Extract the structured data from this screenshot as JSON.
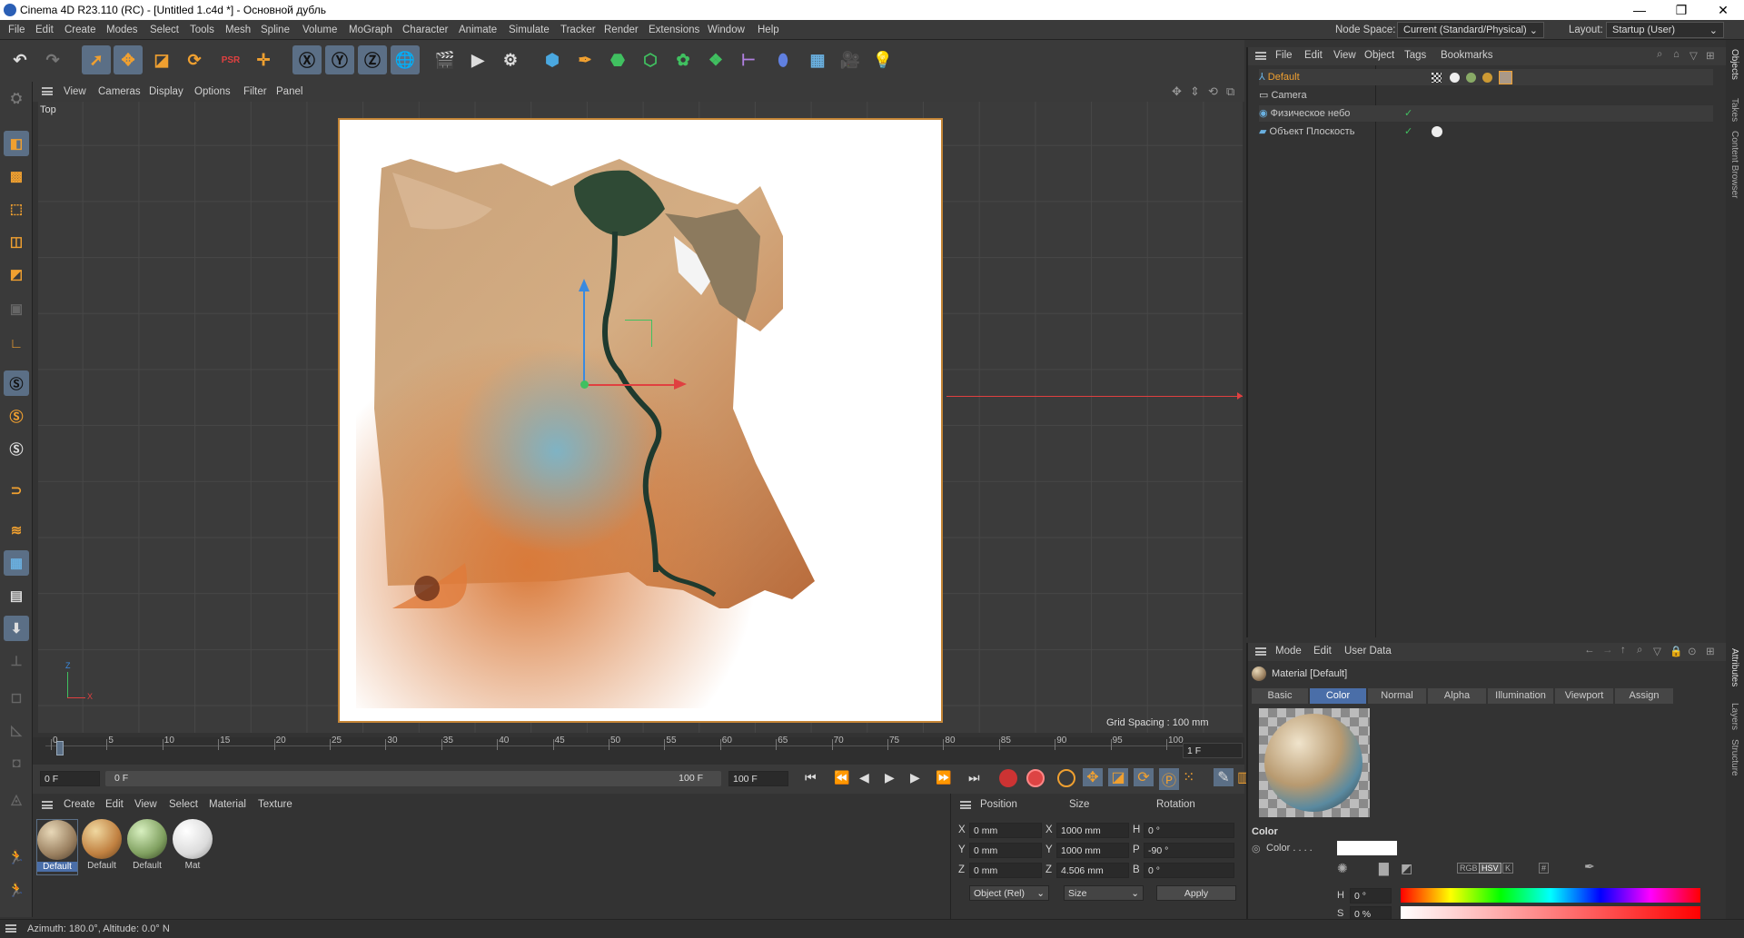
{
  "window": {
    "title": "Cinema 4D R23.110 (RC) - [Untitled 1.c4d *] - Основной дубль",
    "minimize": "—",
    "maximize": "❐",
    "close": "✕"
  },
  "menubar": {
    "items": [
      "File",
      "Edit",
      "Create",
      "Modes",
      "Select",
      "Tools",
      "Mesh",
      "Spline",
      "Volume",
      "MoGraph",
      "Character",
      "Animate",
      "Simulate",
      "Tracker",
      "Render",
      "Extensions",
      "Window",
      "Help"
    ],
    "node_space_label": "Node Space:",
    "node_space_value": "Current (Standard/Physical)",
    "layout_label": "Layout:",
    "layout_value": "Startup (User)"
  },
  "viewport": {
    "menu": [
      "View",
      "Cameras",
      "Display",
      "Options",
      "Filter",
      "Panel"
    ],
    "name": "Top",
    "grid_spacing": "Grid Spacing : 100 mm",
    "axis_z": "Z",
    "axis_x": "X"
  },
  "timeline": {
    "ticks": [
      "0",
      "5",
      "10",
      "15",
      "20",
      "25",
      "30",
      "35",
      "40",
      "45",
      "50",
      "55",
      "60",
      "65",
      "70",
      "75",
      "80",
      "85",
      "90",
      "95",
      "100"
    ],
    "current_frame": "1 F"
  },
  "transport": {
    "start": "0 F",
    "current": "0 F",
    "end_inner": "100 F",
    "end": "100 F"
  },
  "materials": {
    "menu": [
      "Create",
      "Edit",
      "View",
      "Select",
      "Material",
      "Texture"
    ],
    "items": [
      {
        "label": "Default"
      },
      {
        "label": "Default"
      },
      {
        "label": "Default"
      },
      {
        "label": "Mat"
      }
    ]
  },
  "coords": {
    "headers": [
      "Position",
      "Size",
      "Rotation"
    ],
    "rows": [
      {
        "axis": "X",
        "pos": "0 mm",
        "saxis": "X",
        "size": "1000 mm",
        "raxis": "H",
        "rot": "0 °"
      },
      {
        "axis": "Y",
        "pos": "0 mm",
        "saxis": "Y",
        "size": "1000 mm",
        "raxis": "P",
        "rot": "-90 °"
      },
      {
        "axis": "Z",
        "pos": "0 mm",
        "saxis": "Z",
        "size": "4.506 mm",
        "raxis": "B",
        "rot": "0 °"
      }
    ],
    "mode1": "Object (Rel)",
    "mode2": "Size",
    "apply": "Apply"
  },
  "objects": {
    "menu": [
      "File",
      "Edit",
      "View",
      "Object",
      "Tags",
      "Bookmarks"
    ],
    "rows": [
      {
        "name": "Default"
      },
      {
        "name": "Camera"
      },
      {
        "name": "Физическое небо"
      },
      {
        "name": "Объект Плоскость"
      }
    ]
  },
  "attributes": {
    "menu": [
      "Mode",
      "Edit",
      "User Data"
    ],
    "title": "Material [Default]",
    "tabs": [
      "Basic",
      "Color",
      "Normal",
      "Alpha",
      "Illumination",
      "Viewport",
      "Assign"
    ],
    "active_tab": "Color",
    "section": "Color",
    "color_label": "Color . . . .",
    "color_modes": [
      "RGB",
      "HSV",
      "K",
      "#"
    ],
    "h_label": "H",
    "h_value": "0 °",
    "s_label": "S",
    "s_value": "0 %"
  },
  "right_strip": [
    "Objects",
    "Takes",
    "Content Browser",
    "Attributes",
    "Layers",
    "Structure"
  ],
  "status": {
    "text": "Azimuth: 180.0°, Altitude: 0.0°  N"
  },
  "colors": {
    "accent": "#5b6f86",
    "active_tab": "#4a6ea8",
    "selected_text": "#f0a030",
    "frame_border": "#c48536"
  }
}
